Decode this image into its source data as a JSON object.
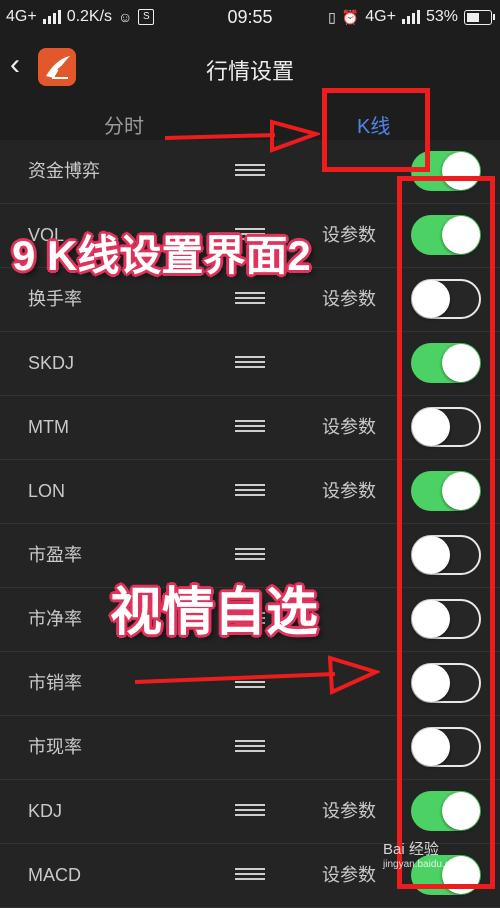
{
  "status_bar": {
    "network_left": "4G+",
    "speed": "0.2K/s",
    "time": "09:55",
    "network_right": "4G+",
    "battery": "53%",
    "battery_level": 0.53
  },
  "header": {
    "back_glyph": "‹",
    "title": "行情设置"
  },
  "tabs": [
    {
      "label": "分时",
      "active": false
    },
    {
      "label": "K线",
      "active": true
    }
  ],
  "rows": [
    {
      "label": "资金博弈",
      "param": "",
      "enabled": true
    },
    {
      "label": "VOL",
      "param": "设参数",
      "enabled": true
    },
    {
      "label": "换手率",
      "param": "设参数",
      "enabled": false
    },
    {
      "label": "SKDJ",
      "param": "",
      "enabled": true
    },
    {
      "label": "MTM",
      "param": "设参数",
      "enabled": false
    },
    {
      "label": "LON",
      "param": "设参数",
      "enabled": true
    },
    {
      "label": "市盈率",
      "param": "",
      "enabled": false
    },
    {
      "label": "市净率",
      "param": "",
      "enabled": false
    },
    {
      "label": "市销率",
      "param": "",
      "enabled": false
    },
    {
      "label": "市现率",
      "param": "",
      "enabled": false
    },
    {
      "label": "KDJ",
      "param": "设参数",
      "enabled": true
    },
    {
      "label": "MACD",
      "param": "设参数",
      "enabled": true
    }
  ],
  "annotations": {
    "caption_top": "9 K线设置界面2",
    "caption_mid": "视情自选"
  },
  "watermark": {
    "brand": "Bai 经验",
    "url": "jingyan.baidu.com"
  },
  "colors": {
    "accent": "#4e86e8",
    "toggle_on": "#4cd264",
    "annotation_red": "#ee1c1c"
  }
}
